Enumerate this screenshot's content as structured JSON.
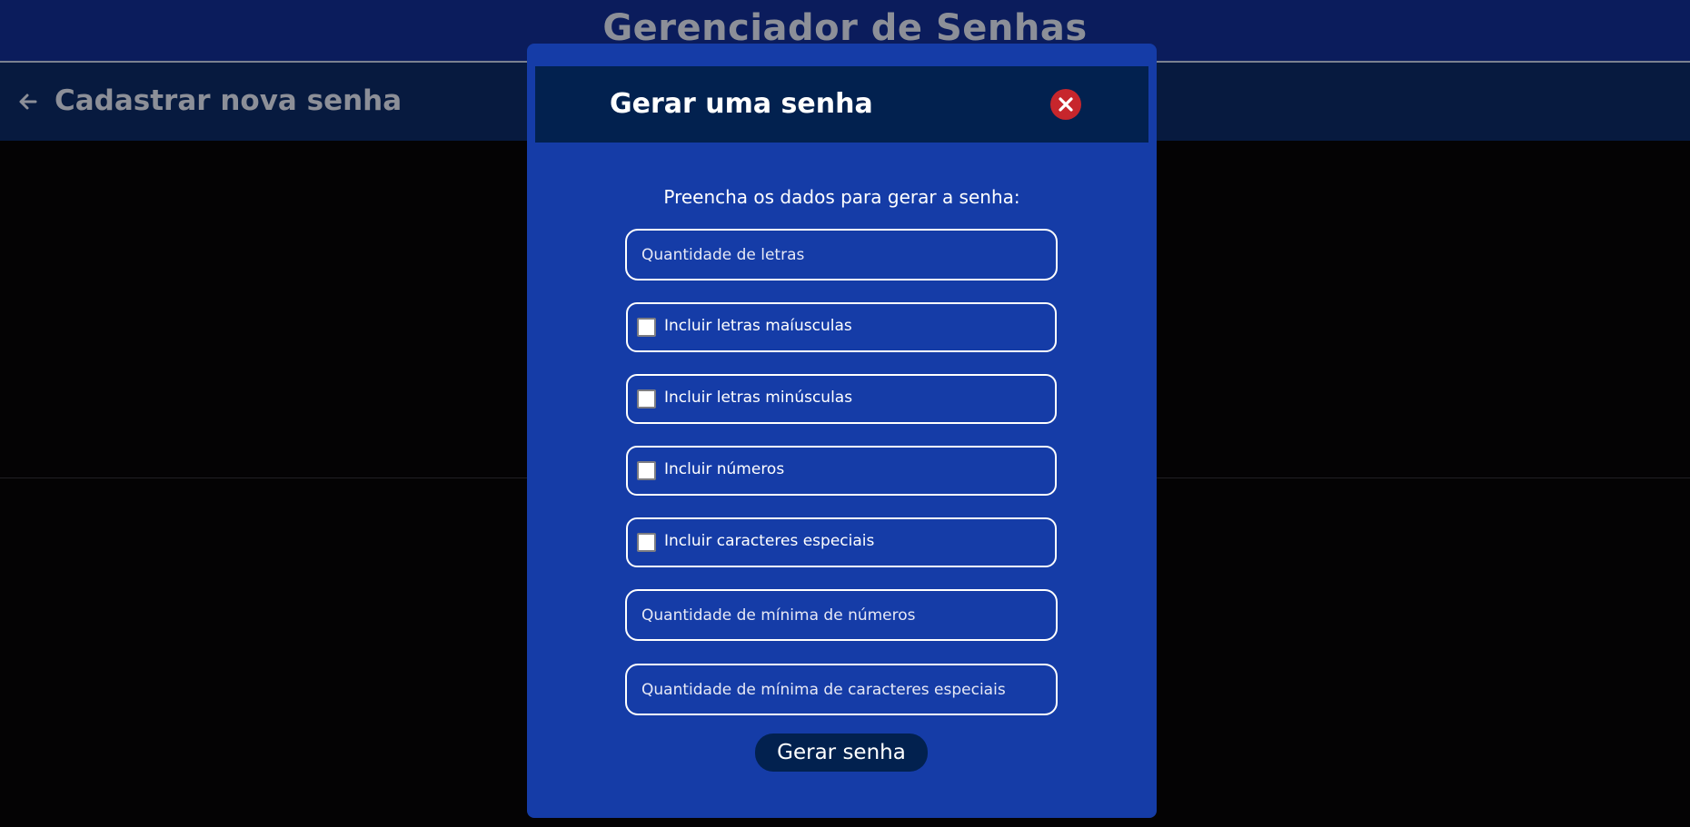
{
  "header": {
    "app_title": "Gerenciador de Senhas"
  },
  "subheader": {
    "back_icon": "arrow-left-icon",
    "title": "Cadastrar nova senha"
  },
  "modal": {
    "title": "Gerar uma senha",
    "close_icon": "close-x-icon",
    "instructions": "Preencha os dados para gerar a senha:",
    "letters_quantity": {
      "placeholder": "Quantidade de letras",
      "value": ""
    },
    "options": [
      {
        "label": "Incluir letras maíusculas",
        "checked": false
      },
      {
        "label": "Incluir letras minúsculas",
        "checked": false
      },
      {
        "label": "Incluir números",
        "checked": false
      },
      {
        "label": "Incluir caracteres especiais",
        "checked": false
      }
    ],
    "min_numbers": {
      "placeholder": "Quantidade de mínima de números",
      "value": ""
    },
    "min_special": {
      "placeholder": "Quantidade de mínima de caracteres especiais",
      "value": ""
    },
    "submit_label": "Gerar senha"
  },
  "colors": {
    "topbar": "#0b1c5c",
    "subbar": "#071a3f",
    "modal": "#153ca7",
    "modal_header": "#02214f",
    "close_button": "#c7262c",
    "muted_text": "#8c8f98"
  }
}
